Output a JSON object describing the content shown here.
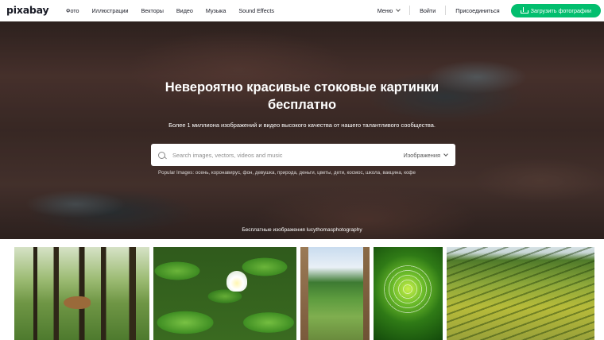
{
  "header": {
    "logo": "pixabay",
    "nav": [
      "Фото",
      "Иллюстрации",
      "Векторы",
      "Видео",
      "Музыка",
      "Sound Effects"
    ],
    "menu_label": "Меню",
    "login_label": "Войти",
    "join_label": "Присоединиться",
    "upload_label": "Загрузить фотографии"
  },
  "hero": {
    "title": "Невероятно красивые стоковые картинки бесплатно",
    "subtitle": "Более 1 миллиона изображений и видео высокого качества от нашего талантливого сообщества.",
    "search_placeholder": "Search images, vectors, videos and music",
    "search_type": "Изображения",
    "popular_label": "Popular Images:",
    "popular_tags": "осень, коронавирус, фон, девушка, природа, деньги, цветы, дети, космос, школа, вакцина, кофе",
    "credit": "Бесплатные изображения lucythomasphotography"
  },
  "thumbnails": [
    {
      "name": "thumb-deer-forest",
      "subject": "deer in forest"
    },
    {
      "name": "thumb-water-lily",
      "subject": "water lily"
    },
    {
      "name": "thumb-landscape-view",
      "subject": "landscape view"
    },
    {
      "name": "thumb-spider-web",
      "subject": "spider web"
    },
    {
      "name": "thumb-rice-terraces",
      "subject": "rice terraces"
    }
  ],
  "colors": {
    "accent": "#02be6e",
    "text": "#191b26"
  }
}
